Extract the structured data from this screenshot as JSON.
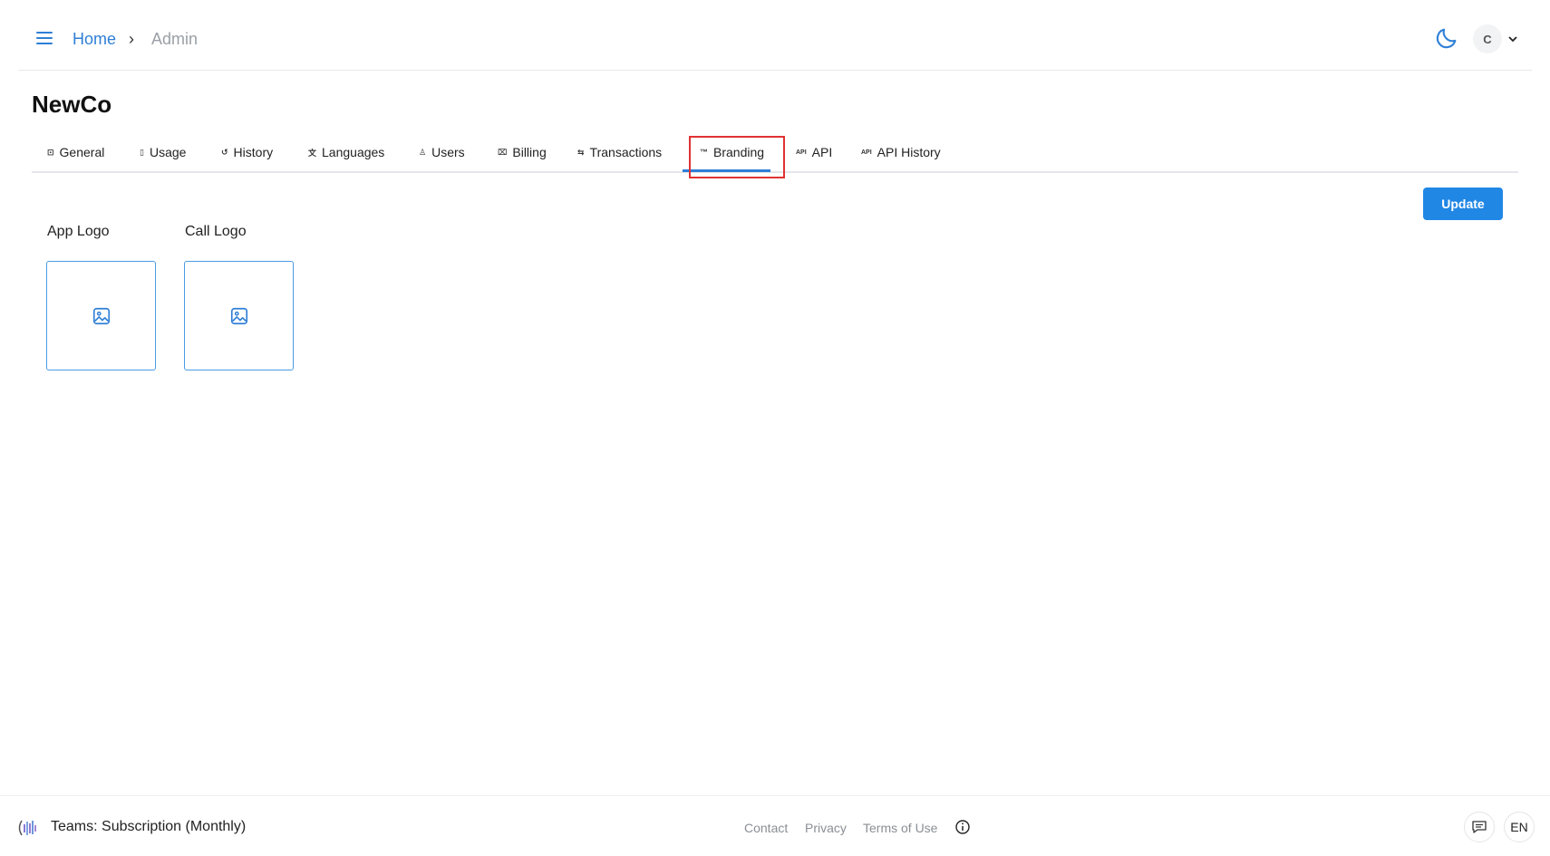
{
  "header": {
    "breadcrumb": {
      "home": "Home",
      "separator": "›",
      "current": "Admin"
    },
    "avatar_initial": "C"
  },
  "page_title": "NewCo",
  "tabs": [
    {
      "icon": "⊡",
      "label": "General"
    },
    {
      "icon": "▯",
      "label": "Usage"
    },
    {
      "icon": "↺",
      "label": "History"
    },
    {
      "icon": "文",
      "label": "Languages"
    },
    {
      "icon": "♙",
      "label": "Users"
    },
    {
      "icon": "⌧",
      "label": "Billing"
    },
    {
      "icon": "⇆",
      "label": "Transactions"
    },
    {
      "icon": "™",
      "label": "Branding"
    },
    {
      "icon": "API",
      "label": "API"
    },
    {
      "icon": "API",
      "label": "API History"
    }
  ],
  "active_tab": "Branding",
  "update_label": "Update",
  "logos": [
    {
      "label": "App Logo"
    },
    {
      "label": "Call Logo"
    }
  ],
  "footer": {
    "plan": "Teams: Subscription (Monthly)",
    "links": [
      "Contact",
      "Privacy",
      "Terms of Use"
    ],
    "language": "EN"
  },
  "colors": {
    "accent": "#2f7fd6",
    "button": "#2187e5",
    "highlight": "#e03232"
  }
}
